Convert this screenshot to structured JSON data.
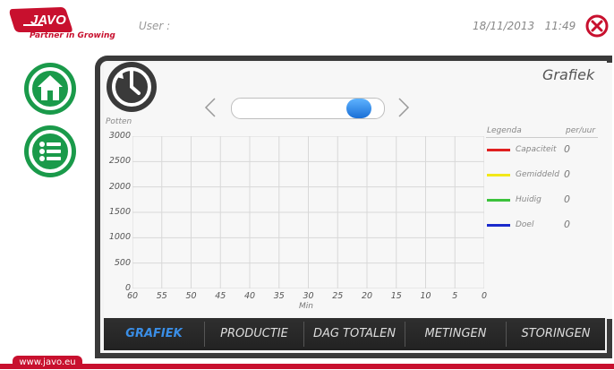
{
  "header": {
    "logo_text": "Partner in Growing",
    "logo_brand": "JAVO",
    "user_label": "User :",
    "date": "18/11/2013",
    "time": "11:49"
  },
  "panel": {
    "title": "Grafiek"
  },
  "chart_data": {
    "type": "line",
    "ylabel": "Potten",
    "xlabel": "Min",
    "yticks": [
      "3000",
      "2500",
      "2000",
      "1500",
      "1000",
      "500",
      "0"
    ],
    "xticks": [
      "60",
      "55",
      "50",
      "45",
      "40",
      "35",
      "30",
      "25",
      "20",
      "15",
      "10",
      "5",
      "0"
    ],
    "ylim": [
      0,
      3000
    ],
    "xlim": [
      60,
      0
    ],
    "grid": true,
    "legend_placement": "right",
    "series": [
      {
        "name": "Capaciteit",
        "color": "#e02020",
        "value": "0"
      },
      {
        "name": "Gemiddeld",
        "color": "#f2e81a",
        "value": "0"
      },
      {
        "name": "Huidig",
        "color": "#3cc23c",
        "value": "0"
      },
      {
        "name": "Doel",
        "color": "#1a2acc",
        "value": "0"
      }
    ]
  },
  "legend": {
    "title": "Legenda",
    "unit": "per/uur"
  },
  "slider": {
    "value_fraction": 0.9
  },
  "tabs": [
    {
      "label": "GRAFIEK",
      "active": true
    },
    {
      "label": "PRODUCTIE",
      "active": false
    },
    {
      "label": "DAG TOTALEN",
      "active": false
    },
    {
      "label": "METINGEN",
      "active": false
    },
    {
      "label": "STORINGEN",
      "active": false
    }
  ],
  "footer": {
    "url": "www.javo.eu"
  },
  "colors": {
    "brand_red": "#c8102e",
    "nav_green": "#1a9a4a",
    "accent_blue": "#3a8ee6"
  }
}
